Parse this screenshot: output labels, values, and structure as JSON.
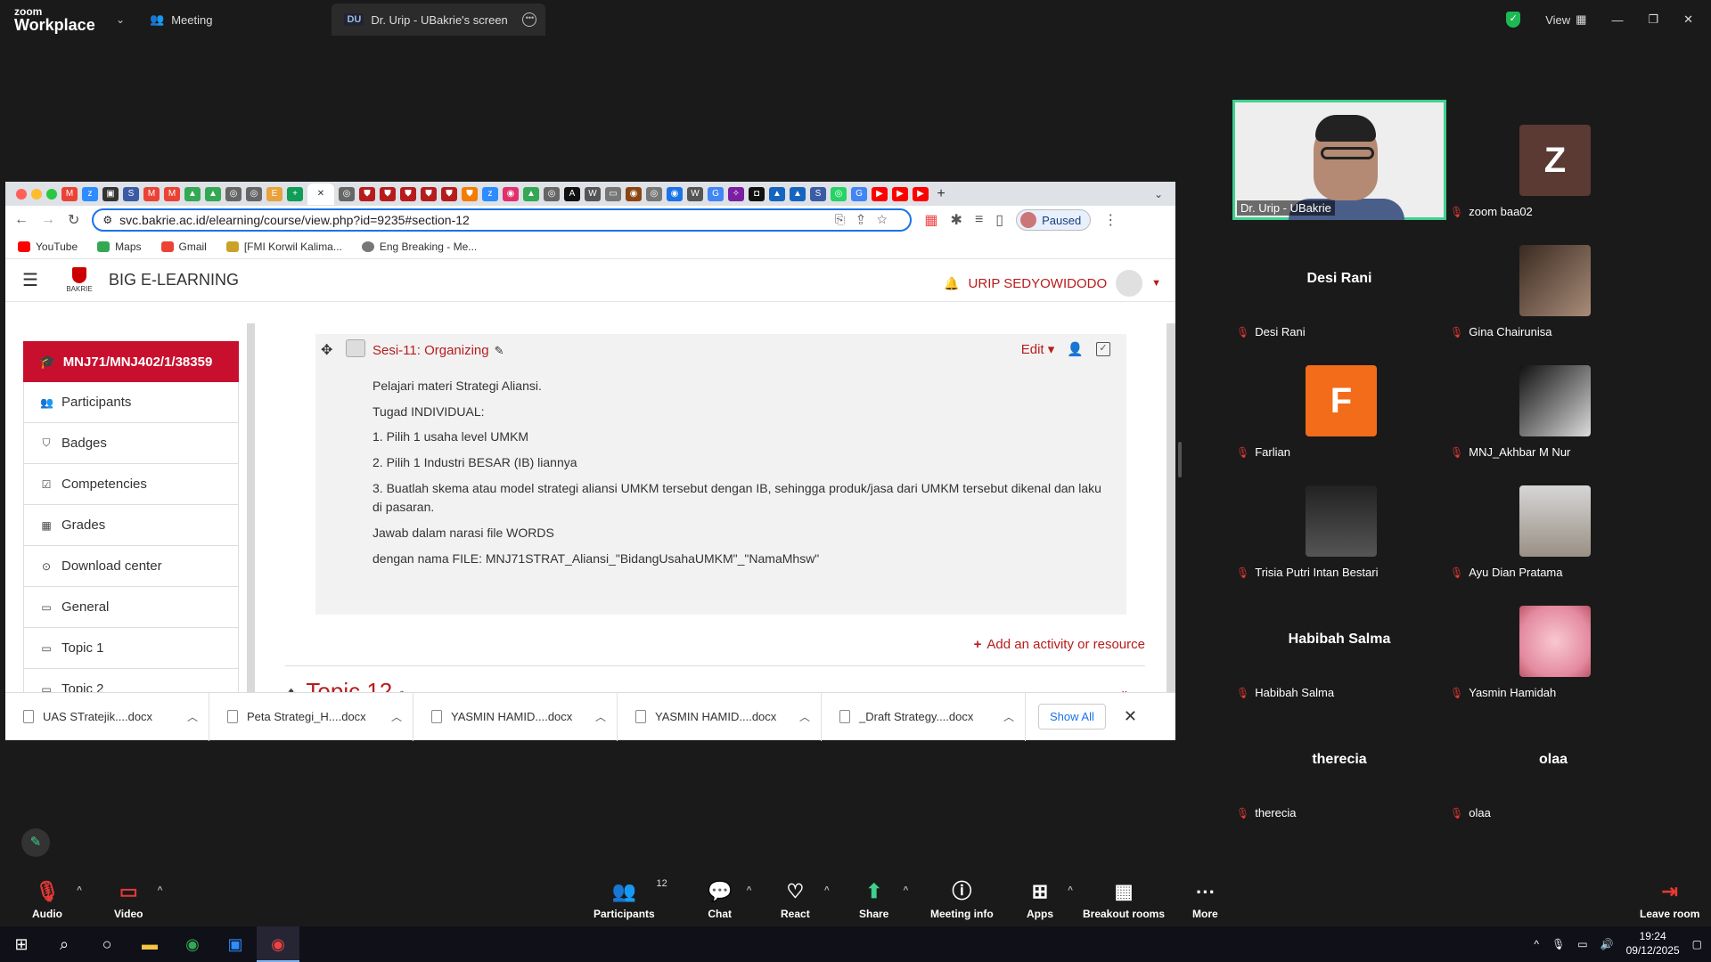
{
  "zoom": {
    "brand_top": "zoom",
    "brand_bottom": "Workplace",
    "meeting_label": "Meeting",
    "screen_tab_initials": "DU",
    "screen_tab_label": "Dr. Urip - UBakrie's screen",
    "view_label": "View"
  },
  "browser": {
    "url": "svc.bakrie.ac.id/elearning/course/view.php?id=9235#section-12",
    "profile_status": "Paused",
    "bookmarks": [
      "YouTube",
      "Maps",
      "Gmail",
      "[FMI Korwil Kalima...",
      "Eng Breaking - Me..."
    ]
  },
  "moodle": {
    "site_name": "BIG E-LEARNING",
    "logo_text": "BAKRIE",
    "user_name": "URIP SEDYOWIDODO",
    "course_code": "MNJ71/MNJ402/1/38359",
    "nav": [
      "Participants",
      "Badges",
      "Competencies",
      "Grades",
      "Download center",
      "General",
      "Topic 1",
      "Topic 2"
    ],
    "section_title": "Sesi-11: Organizing",
    "edit_label": "Edit",
    "section_lines": [
      "Pelajari materi Strategi Aliansi.",
      "Tugad INDIVIDUAL:",
      "1. Pilih 1 usaha level UMKM",
      "2. Pilih 1 Industri BESAR (IB) liannya",
      "3. Buatlah skema atau model strategi aliansi UMKM tersebut dengan IB, sehingga produk/jasa dari UMKM tersebut dikenal dan laku di pasaran.",
      "Jawab dalam narasi file WORDS",
      "dengan nama FILE: MNJ71STRAT_Aliansi_\"BidangUsahaUMKM\"_\"NamaMhsw\""
    ],
    "add_activity": "Add an activity or resource",
    "next_topic": "Topic 12"
  },
  "downloads": {
    "files": [
      "UAS STratejik....docx",
      "Peta Strategi_H....docx",
      "YASMIN HAMID....docx",
      "YASMIN HAMID....docx",
      "_Draft Strategy....docx"
    ],
    "show_all": "Show All"
  },
  "participants": [
    {
      "name": "Dr. Urip - UBakrie",
      "display": "speaker"
    },
    {
      "name": "zoom baa02",
      "display": "Z",
      "color": "#5a3a33"
    },
    {
      "name": "Desi Rani",
      "display": "Desi Rani"
    },
    {
      "name": "Gina Chairunisa",
      "display": "photo"
    },
    {
      "name": "Farlian",
      "display": "F",
      "color": "#f26c1a"
    },
    {
      "name": "MNJ_Akhbar M Nur",
      "display": "photo"
    },
    {
      "name": "Trisia Putri Intan Bestari",
      "display": "photo"
    },
    {
      "name": "Ayu Dian Pratama",
      "display": "photo"
    },
    {
      "name": "Habibah Salma",
      "display": "Habibah Salma"
    },
    {
      "name": "Yasmin Hamidah",
      "display": "photo"
    },
    {
      "name": "therecia",
      "display": "therecia"
    },
    {
      "name": "olaa",
      "display": "olaa"
    }
  ],
  "toolbar": {
    "audio": "Audio",
    "video": "Video",
    "participants": "Participants",
    "participant_count": "12",
    "chat": "Chat",
    "react": "React",
    "share": "Share",
    "meeting_info": "Meeting info",
    "apps": "Apps",
    "breakout": "Breakout rooms",
    "more": "More",
    "leave": "Leave room"
  },
  "taskbar": {
    "time": "19:24",
    "date": "09/12/2025"
  }
}
